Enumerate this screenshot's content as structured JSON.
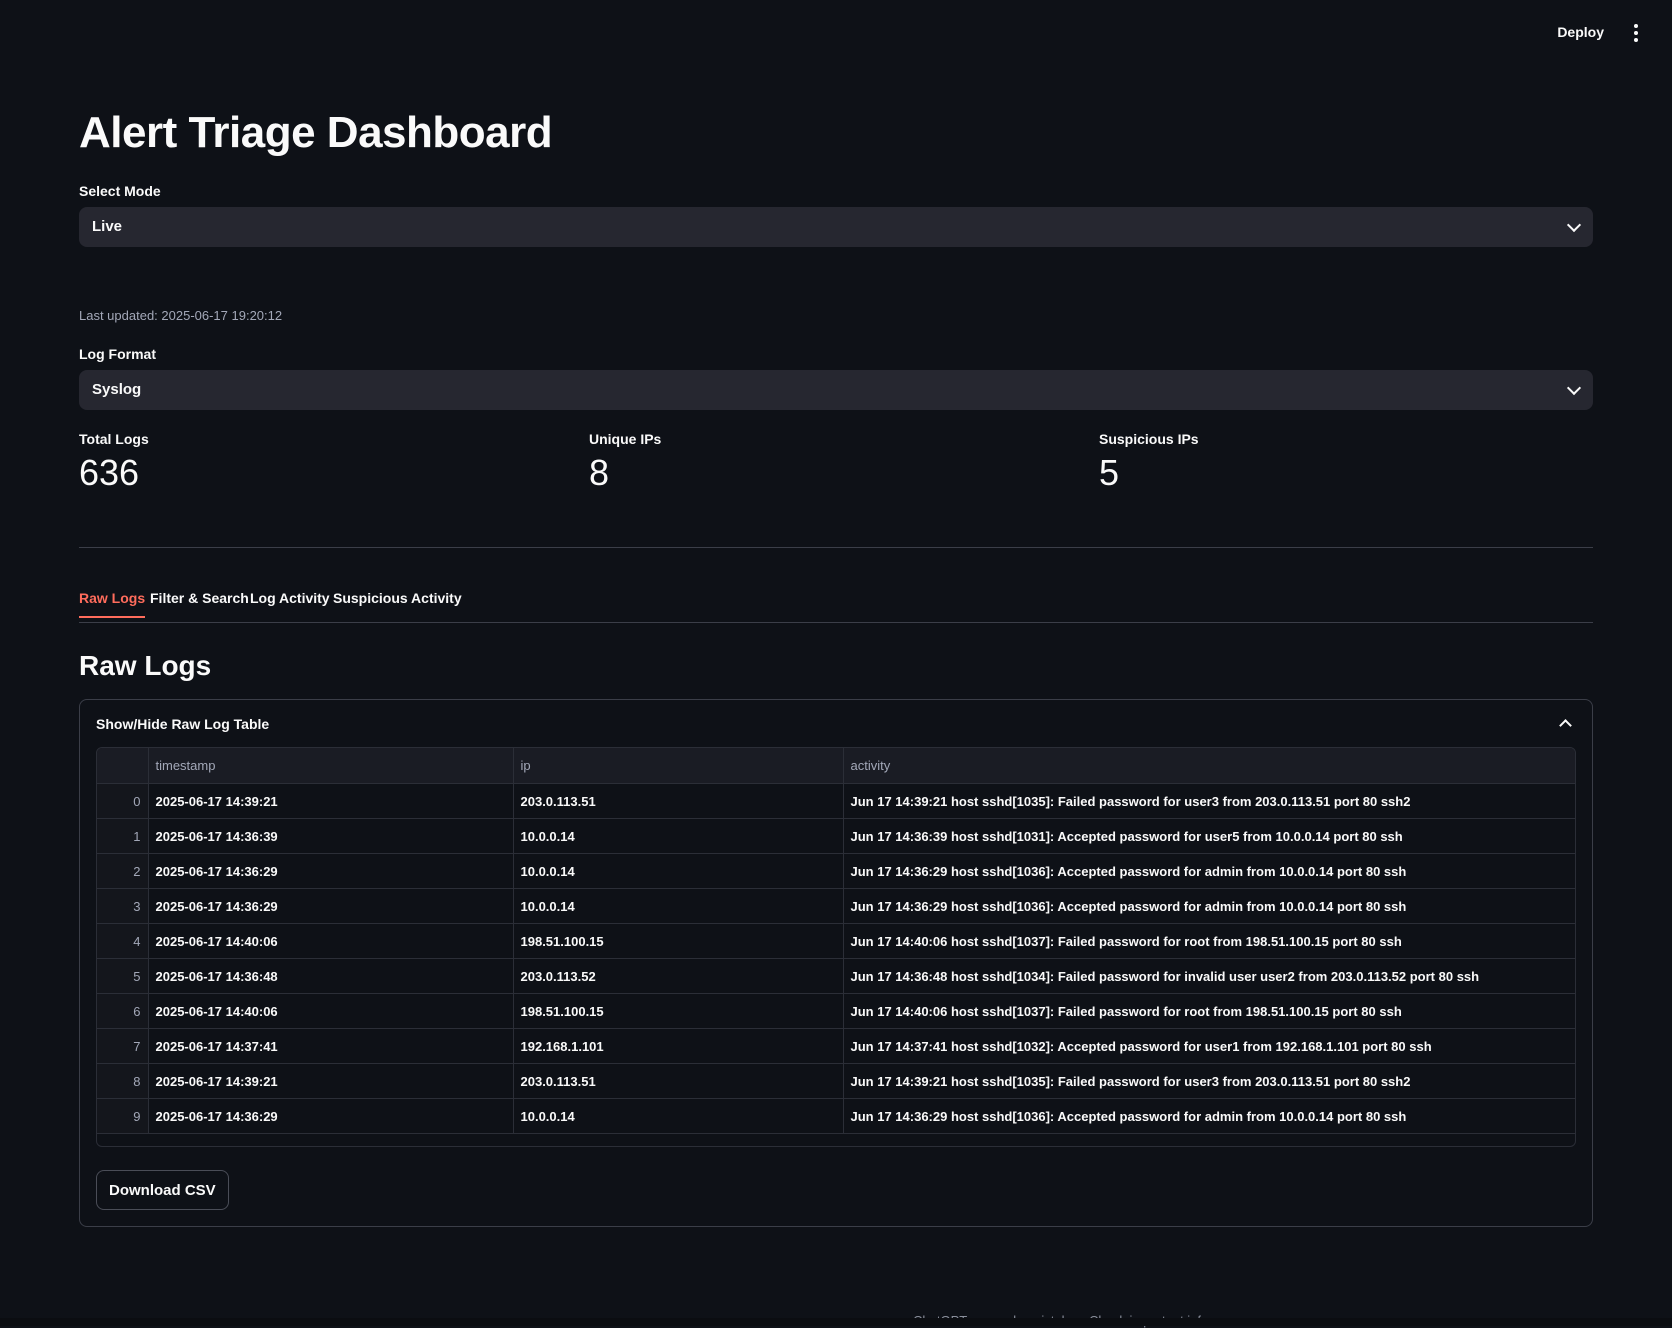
{
  "header": {
    "deploy_label": "Deploy"
  },
  "page": {
    "title": "Alert Triage Dashboard"
  },
  "mode": {
    "label": "Select Mode",
    "value": "Live"
  },
  "status": {
    "last_updated": "Last updated: 2025-06-17 19:20:12"
  },
  "format": {
    "label": "Log Format",
    "value": "Syslog"
  },
  "metrics": [
    {
      "label": "Total Logs",
      "value": "636"
    },
    {
      "label": "Unique IPs",
      "value": "8"
    },
    {
      "label": "Suspicious IPs",
      "value": "5"
    }
  ],
  "tabs": [
    {
      "label": "Raw Logs",
      "active": true
    },
    {
      "label": "Filter & Search",
      "active": false
    },
    {
      "label": "Log Activity",
      "active": false
    },
    {
      "label": "Suspicious Activity",
      "active": false
    }
  ],
  "section": {
    "title": "Raw Logs"
  },
  "expander": {
    "title": "Show/Hide Raw Log Table"
  },
  "table": {
    "columns": [
      "",
      "timestamp",
      "ip",
      "activity"
    ],
    "rows": [
      [
        "0",
        "2025-06-17 14:39:21",
        "203.0.113.51",
        "Jun 17 14:39:21 host sshd[1035]: Failed password for user3 from 203.0.113.51 port 80 ssh2"
      ],
      [
        "1",
        "2025-06-17 14:36:39",
        "10.0.0.14",
        "Jun 17 14:36:39 host sshd[1031]: Accepted password for user5 from 10.0.0.14 port 80 ssh"
      ],
      [
        "2",
        "2025-06-17 14:36:29",
        "10.0.0.14",
        "Jun 17 14:36:29 host sshd[1036]: Accepted password for admin from 10.0.0.14 port 80 ssh"
      ],
      [
        "3",
        "2025-06-17 14:36:29",
        "10.0.0.14",
        "Jun 17 14:36:29 host sshd[1036]: Accepted password for admin from 10.0.0.14 port 80 ssh"
      ],
      [
        "4",
        "2025-06-17 14:40:06",
        "198.51.100.15",
        "Jun 17 14:40:06 host sshd[1037]: Failed password for root from 198.51.100.15 port 80 ssh"
      ],
      [
        "5",
        "2025-06-17 14:36:48",
        "203.0.113.52",
        "Jun 17 14:36:48 host sshd[1034]: Failed password for invalid user user2 from 203.0.113.52 port 80 ssh"
      ],
      [
        "6",
        "2025-06-17 14:40:06",
        "198.51.100.15",
        "Jun 17 14:40:06 host sshd[1037]: Failed password for root from 198.51.100.15 port 80 ssh"
      ],
      [
        "7",
        "2025-06-17 14:37:41",
        "192.168.1.101",
        "Jun 17 14:37:41 host sshd[1032]: Accepted password for user1 from 192.168.1.101 port 80 ssh"
      ],
      [
        "8",
        "2025-06-17 14:39:21",
        "203.0.113.51",
        "Jun 17 14:39:21 host sshd[1035]: Failed password for user3 from 203.0.113.51 port 80 ssh2"
      ],
      [
        "9",
        "2025-06-17 14:36:29",
        "10.0.0.14",
        "Jun 17 14:36:29 host sshd[1036]: Accepted password for admin from 10.0.0.14 port 80 ssh"
      ]
    ]
  },
  "download": {
    "label": "Download CSV"
  },
  "footer": {
    "note": "ChatGPT can make mistakes. Check important info."
  },
  "colors": {
    "background": "#0e1117",
    "accent": "#ff6c5c",
    "input_bg": "#262730"
  }
}
